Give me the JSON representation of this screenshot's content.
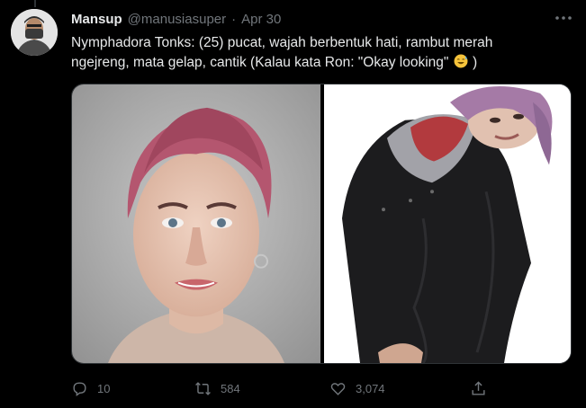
{
  "tweet": {
    "display_name": "Mansup",
    "handle": "@manusiasuper",
    "separator": "·",
    "timestamp": "Apr 30",
    "text_line1": "Nymphadora Tonks: (25) pucat, wajah berbentuk hati, rambut merah",
    "text_line2a": "ngejreng, mata gelap, cantik (Kalau kata Ron: \"Okay looking\"",
    "text_line2b": ")",
    "emoji": "sweat-smile-emoji"
  },
  "media": {
    "photos": [
      "portrait-left",
      "portrait-right"
    ]
  },
  "actions": {
    "reply_count": "10",
    "retweet_count": "584",
    "like_count": "3,074"
  },
  "colors": {
    "background": "#000000",
    "primary_text": "#e7e9ea",
    "secondary_text": "#71767b",
    "border": "#2f3336"
  }
}
